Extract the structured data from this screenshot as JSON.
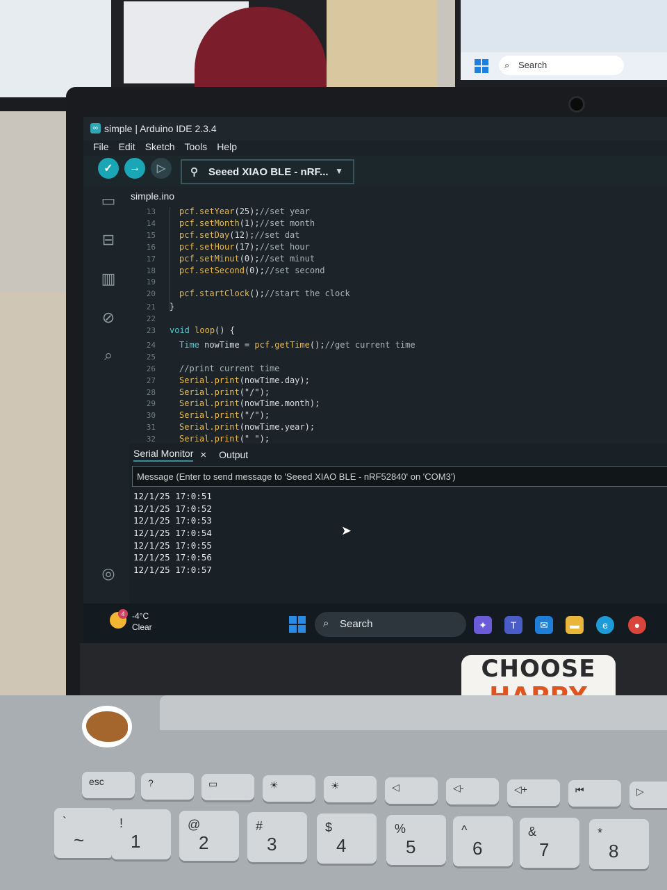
{
  "window": {
    "title": "simple | Arduino IDE 2.3.4",
    "app_icon": "arduino-icon"
  },
  "menu": [
    "File",
    "Edit",
    "Sketch",
    "Tools",
    "Help"
  ],
  "toolbar": {
    "verify_icon": "check-icon",
    "upload_icon": "arrow-right-icon",
    "debug_icon": "debug-icon",
    "board": "Seeed XIAO BLE - nRF..."
  },
  "sidebar": [
    "folder-icon",
    "board-manager-icon",
    "library-icon",
    "debug-icon",
    "search-icon",
    "account-icon"
  ],
  "editor": {
    "tab": "simple.ino",
    "lines": [
      {
        "n": "13",
        "text": "pcf.setYear(25);//set year"
      },
      {
        "n": "14",
        "text": "pcf.setMonth(1);//set month"
      },
      {
        "n": "15",
        "text": "pcf.setDay(12);//set dat"
      },
      {
        "n": "16",
        "text": "pcf.setHour(17);//set hour"
      },
      {
        "n": "17",
        "text": "pcf.setMinut(0);//set minut"
      },
      {
        "n": "18",
        "text": "pcf.setSecond(0);//set second"
      },
      {
        "n": "19",
        "text": ""
      },
      {
        "n": "20",
        "text": "pcf.startClock();//start the clock"
      },
      {
        "n": "21",
        "text": "}"
      },
      {
        "n": "22",
        "text": ""
      },
      {
        "n": "23",
        "text": "void loop() {"
      },
      {
        "n": "24",
        "text": "Time nowTime = pcf.getTime();//get current time"
      },
      {
        "n": "25",
        "text": ""
      },
      {
        "n": "26",
        "text": "//print current time"
      },
      {
        "n": "27",
        "text": "Serial.print(nowTime.day);"
      },
      {
        "n": "28",
        "text": "Serial.print(\"/\");"
      },
      {
        "n": "29",
        "text": "Serial.print(nowTime.month);"
      },
      {
        "n": "30",
        "text": "Serial.print(\"/\");"
      },
      {
        "n": "31",
        "text": "Serial.print(nowTime.year);"
      },
      {
        "n": "32",
        "text": "Serial.print(\" \");"
      }
    ]
  },
  "panel": {
    "tabs": [
      "Serial Monitor",
      "Output"
    ],
    "close": "×",
    "message_placeholder": "Message (Enter to send message to 'Seeed XIAO BLE - nRF52840' on 'COM3')",
    "output": [
      "12/1/25 17:0:51",
      "12/1/25 17:0:52",
      "12/1/25 17:0:53",
      "12/1/25 17:0:54",
      "12/1/25 17:0:55",
      "12/1/25 17:0:56",
      "12/1/25 17:0:57"
    ]
  },
  "taskbar": {
    "weather_badge": "4",
    "temperature": "-4°C",
    "condition": "Clear",
    "search": "Search",
    "apps": [
      "copilot-icon",
      "teams-icon",
      "mail-icon",
      "file-explorer-icon",
      "edge-icon",
      "chrome-icon"
    ]
  },
  "background_monitor": {
    "search": "Search"
  },
  "sticker": {
    "line1": "CHOOSE",
    "line2": "HAPPY"
  },
  "keyboard": {
    "fkeys": [
      "esc",
      "?",
      "▭",
      "☀",
      "☀",
      "◁",
      "◁-",
      "◁+",
      "⏮",
      "▷"
    ],
    "numkeys": [
      "~",
      "1",
      "2",
      "3",
      "4",
      "5",
      "6",
      "7",
      "8"
    ],
    "numkeys_top": [
      "`",
      "!",
      "@",
      "#",
      "$",
      "%",
      "^",
      "&",
      "*"
    ]
  }
}
